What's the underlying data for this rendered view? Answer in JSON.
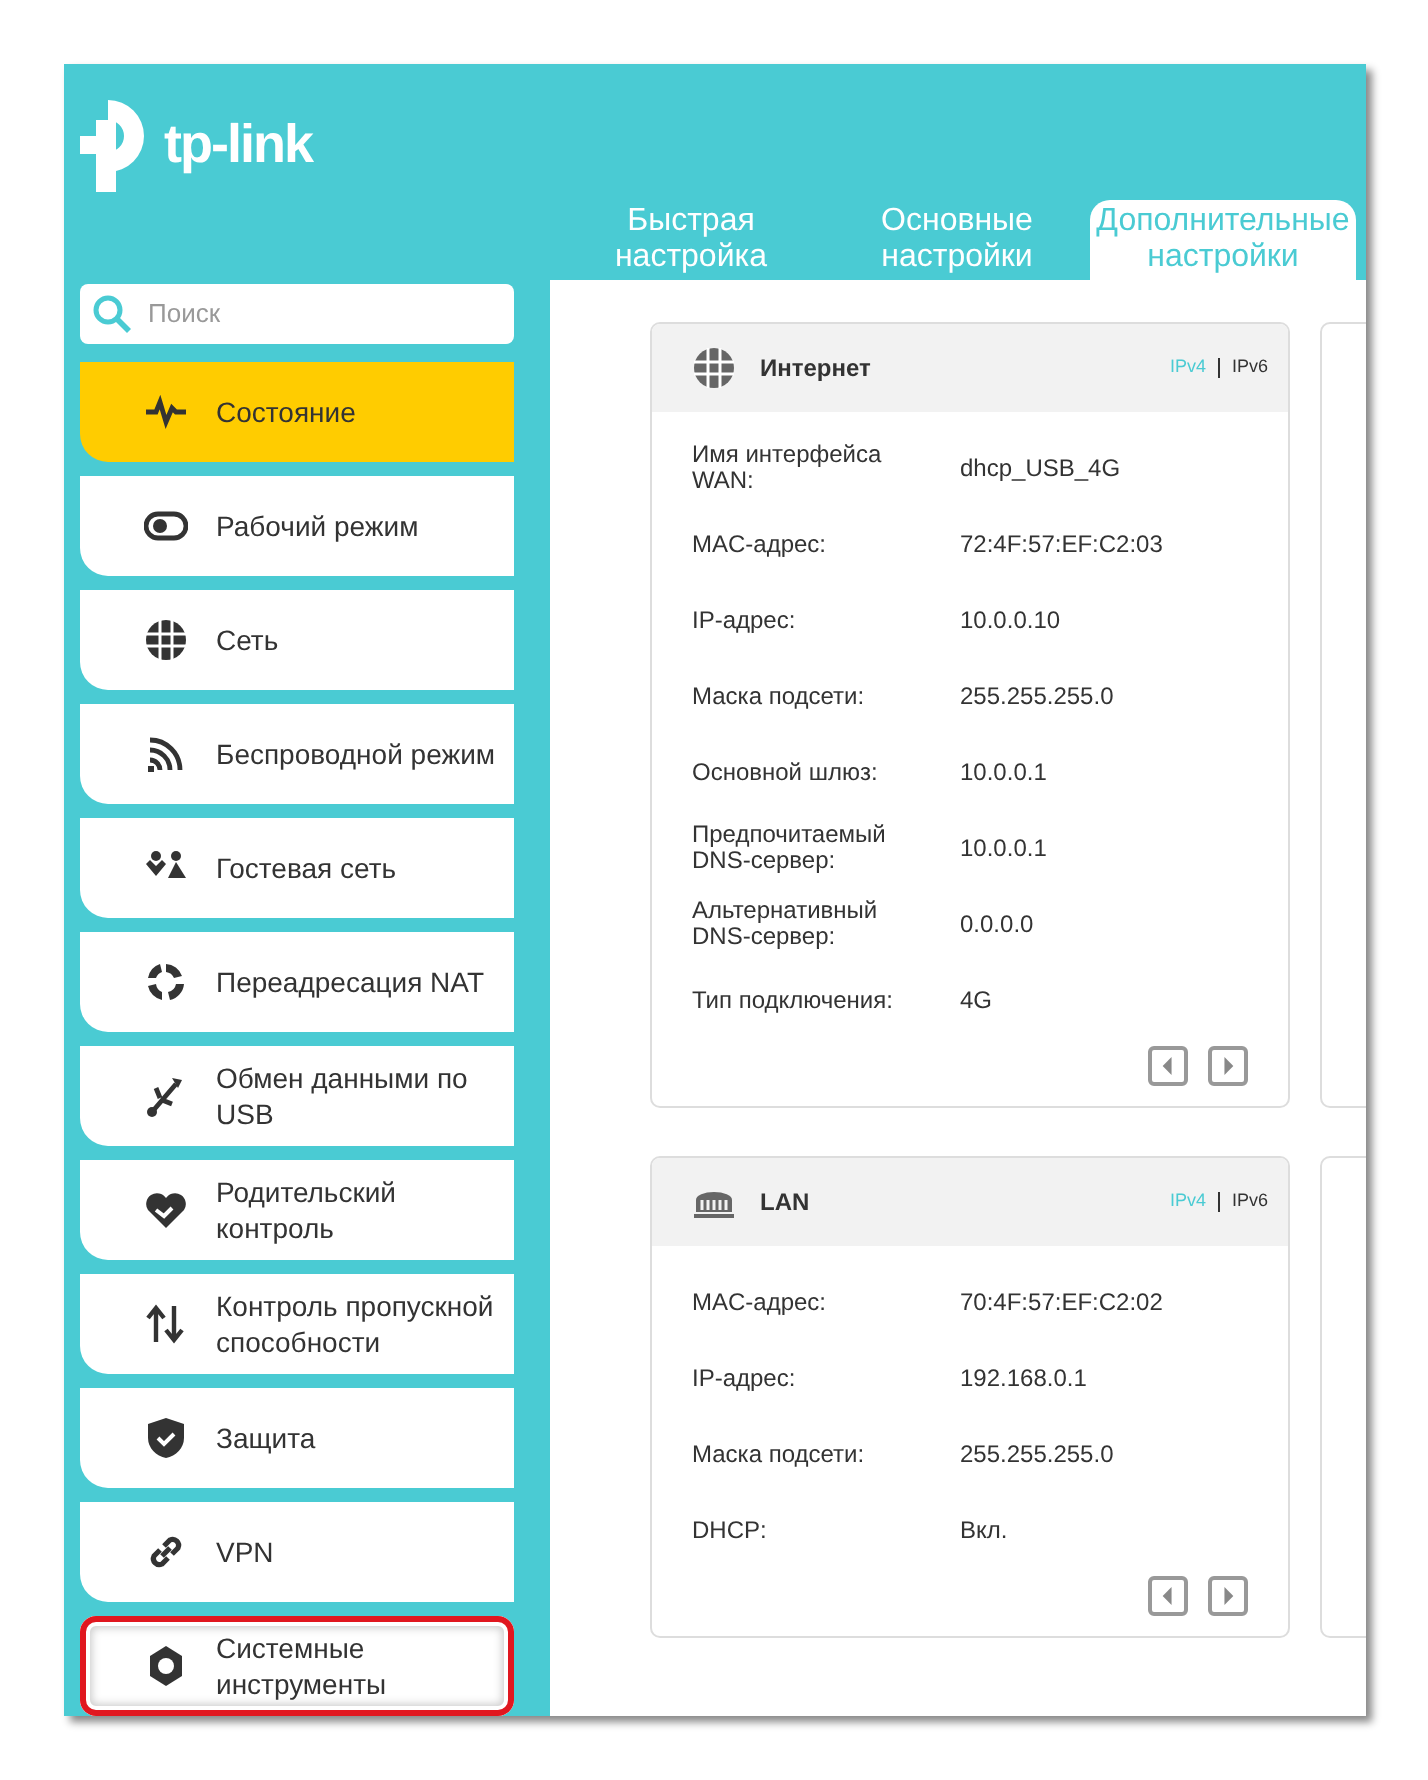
{
  "logo": {
    "text": "tp-link"
  },
  "tabs": [
    {
      "label": "Быстрая настройка",
      "selected": false
    },
    {
      "label": "Основные настройки",
      "selected": false
    },
    {
      "label": "Дополнительные настройки",
      "selected": true
    }
  ],
  "search": {
    "placeholder": "Поиск"
  },
  "menu": [
    {
      "kind": "pulse",
      "label": "Состояние",
      "selected": true,
      "highlighted": false
    },
    {
      "kind": "toggle",
      "label": "Рабочий режим",
      "selected": false,
      "highlighted": false
    },
    {
      "kind": "globe",
      "label": "Сеть",
      "selected": false,
      "highlighted": false
    },
    {
      "kind": "wifi",
      "label": "Беспроводной режим",
      "selected": false,
      "highlighted": false
    },
    {
      "kind": "people",
      "label": "Гостевая сеть",
      "selected": false,
      "highlighted": false
    },
    {
      "kind": "cycle",
      "label": "Переадресация NAT",
      "selected": false,
      "highlighted": false
    },
    {
      "kind": "usb",
      "label": "Обмен данными по USB",
      "selected": false,
      "highlighted": false
    },
    {
      "kind": "heart",
      "label": "Родительский контроль",
      "selected": false,
      "highlighted": false
    },
    {
      "kind": "arrows",
      "label": "Контроль пропускной способности",
      "selected": false,
      "highlighted": false
    },
    {
      "kind": "shield",
      "label": "Защита",
      "selected": false,
      "highlighted": false
    },
    {
      "kind": "link",
      "label": "VPN",
      "selected": false,
      "highlighted": false
    },
    {
      "kind": "gear",
      "label": "Системные инструменты",
      "selected": false,
      "highlighted": true
    }
  ],
  "cards": [
    {
      "kind": "globe",
      "title": "Интернет",
      "modes": [
        {
          "label": "IPv4",
          "selected": true
        },
        {
          "label": "IPv6",
          "selected": false
        }
      ],
      "rows": [
        {
          "label": "Имя интерфейса WAN:",
          "value": "dhcp_USB_4G"
        },
        {
          "label": "MAC-адрес:",
          "value": "72:4F:57:EF:C2:03"
        },
        {
          "label": "IP-адрес:",
          "value": "10.0.0.10"
        },
        {
          "label": "Маска подсети:",
          "value": "255.255.255.0"
        },
        {
          "label": "Основной шлюз:",
          "value": "10.0.0.1"
        },
        {
          "label": "Предпочитаемый DNS-сервер:",
          "value": "10.0.0.1"
        },
        {
          "label": "Альтернативный DNS-сервер:",
          "value": "0.0.0.0"
        },
        {
          "label": "Тип подключения:",
          "value": "4G"
        }
      ]
    },
    {
      "kind": "lan",
      "title": "LAN",
      "modes": [
        {
          "label": "IPv4",
          "selected": true
        },
        {
          "label": "IPv6",
          "selected": false
        }
      ],
      "rows": [
        {
          "label": "MAC-адрес:",
          "value": "70:4F:57:EF:C2:02"
        },
        {
          "label": "IP-адрес:",
          "value": "192.168.0.1"
        },
        {
          "label": "Маска подсети:",
          "value": "255.255.255.0"
        },
        {
          "label": "DHCP:",
          "value": "Вкл."
        }
      ]
    }
  ]
}
